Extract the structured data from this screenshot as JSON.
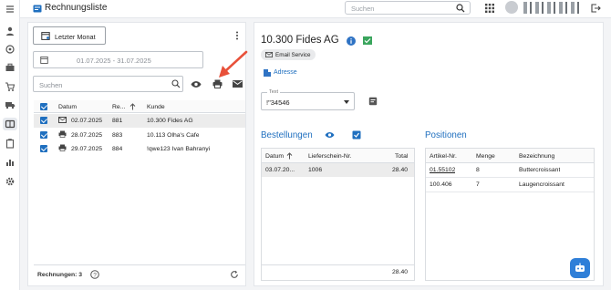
{
  "app": {
    "title": "Rechnungsliste"
  },
  "search": {
    "placeholder": "Suchen"
  },
  "sidebar": {
    "icons": [
      "menu-icon",
      "user-icon",
      "target-icon",
      "briefcase-icon",
      "cart-icon",
      "truck-icon",
      "invoice-icon",
      "clipboard-icon",
      "bar-chart-icon",
      "gear-icon"
    ]
  },
  "invoice_list": {
    "period_button": "Letzter Monat",
    "date_range": "01.07.2025 - 31.07.2025",
    "search_placeholder": "Suchen",
    "columns": {
      "date": "Datum",
      "number": "Re...",
      "customer": "Kunde"
    },
    "rows": [
      {
        "icon": "email-icon",
        "date": "02.07.2025",
        "number": "881",
        "customer": "10.300 Fides AG"
      },
      {
        "icon": "printer-icon",
        "date": "28.07.2025",
        "number": "883",
        "customer": "10.113 Olha's Cafe"
      },
      {
        "icon": "printer-icon",
        "date": "29.07.2025",
        "number": "884",
        "customer": "!qwe123 Ivan Bahranyi"
      }
    ],
    "footer": "Rechnungen: 3"
  },
  "detail": {
    "customer_title": "10.300 Fides AG",
    "service_chip": "Email Service",
    "address_link": "Adresse",
    "text_field": {
      "label": "Text",
      "value": "!\"34546"
    },
    "orders": {
      "title": "Bestellungen",
      "columns": {
        "date": "Datum",
        "delivery": "Lieferschein-Nr.",
        "total": "Total"
      },
      "rows": [
        {
          "date": "03.07.20...",
          "delivery": "1006",
          "total": "28.40"
        }
      ],
      "footer_total": "28.40"
    },
    "positions": {
      "title": "Positionen",
      "columns": {
        "article": "Artikel-Nr.",
        "qty": "Menge",
        "desc": "Bezeichnung"
      },
      "rows": [
        {
          "article": "01.55102",
          "qty": "8",
          "desc": "Buttercroissant"
        },
        {
          "article": "100.406",
          "qty": "7",
          "desc": "Laugencroissant"
        }
      ]
    }
  },
  "colors": {
    "accent": "#1f6fbf",
    "arrow": "#e8513a",
    "selected_row": "#ececec"
  }
}
